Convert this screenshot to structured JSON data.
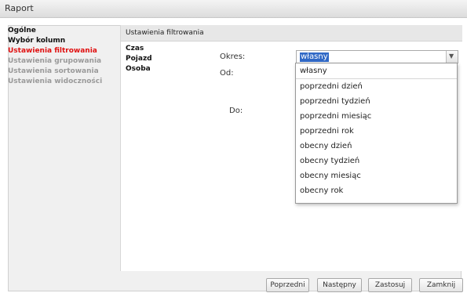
{
  "window": {
    "title": "Raport"
  },
  "sidebar": {
    "items": [
      {
        "label": "Ogólne",
        "state": "normal"
      },
      {
        "label": "Wybór kolumn",
        "state": "normal"
      },
      {
        "label": "Ustawienia filtrowania",
        "state": "active"
      },
      {
        "label": "Ustawienia grupowania",
        "state": "disabled"
      },
      {
        "label": "Ustawienia sortowania",
        "state": "disabled"
      },
      {
        "label": "Ustawienia widoczności",
        "state": "disabled"
      }
    ]
  },
  "main": {
    "header": "Ustawienia filtrowania",
    "subnav": [
      "Czas",
      "Pojazd",
      "Osoba"
    ],
    "fields": {
      "okres_label": "Okres:",
      "od_label": "Od:",
      "do_label": "Do:"
    },
    "select": {
      "value": "własny",
      "options": [
        "własny",
        "poprzedni dzień",
        "poprzedni tydzień",
        "poprzedni miesiąc",
        "poprzedni rok",
        "obecny dzień",
        "obecny tydzień",
        "obecny miesiąc",
        "obecny rok"
      ]
    }
  },
  "footer": {
    "prev": "Poprzedni",
    "next": "Następny",
    "apply": "Zastosuj",
    "close": "Zamknij"
  },
  "colors": {
    "active_item": "#e01010",
    "selection": "#3169c6",
    "disabled_item": "#9a9a9a"
  }
}
